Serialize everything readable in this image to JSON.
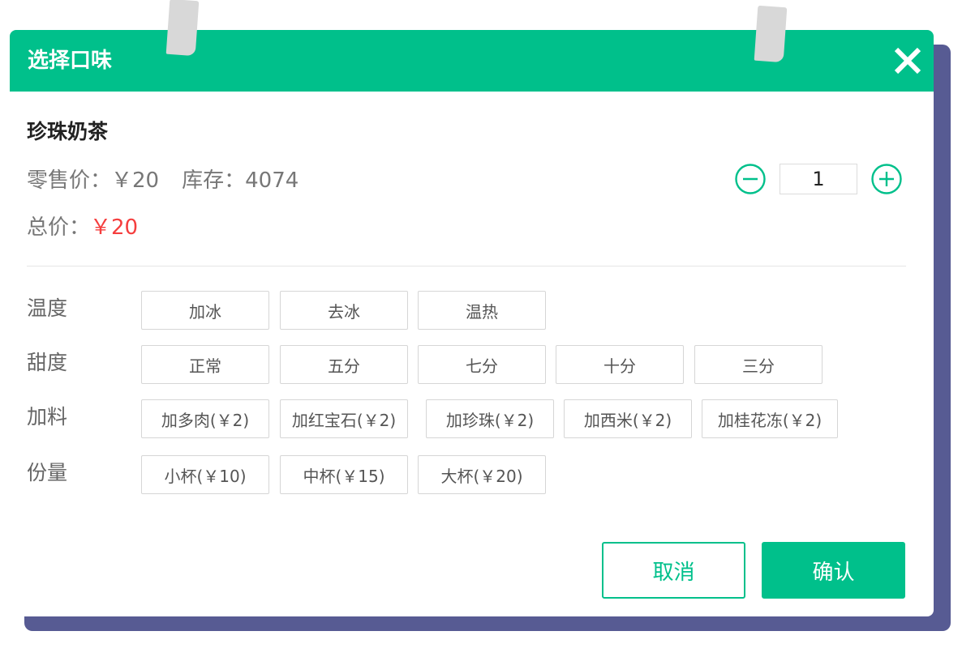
{
  "dialog": {
    "title": "选择口味",
    "close_icon": "close-icon"
  },
  "product": {
    "name": "珍珠奶茶",
    "retail_label": "零售价：",
    "retail_price": "￥20",
    "stock_label": "库存：",
    "stock": "4074",
    "total_label": "总价：",
    "total_price": "￥20"
  },
  "quantity": {
    "value": "1",
    "minus_icon": "minus-circle-icon",
    "plus_icon": "plus-circle-icon"
  },
  "options": {
    "temperature": {
      "label": "温度",
      "items": [
        "加冰",
        "去冰",
        "温热"
      ]
    },
    "sweetness": {
      "label": "甜度",
      "items": [
        "正常",
        "五分",
        "七分",
        "十分",
        "三分"
      ]
    },
    "toppings": {
      "label": "加料",
      "items": [
        "加多肉(￥2)",
        "加红宝石(￥2)",
        "加珍珠(￥2)",
        "加西米(￥2)",
        "加桂花冻(￥2)"
      ]
    },
    "size": {
      "label": "份量",
      "items": [
        "小杯(￥10)",
        "中杯(￥15)",
        "大杯(￥20)"
      ]
    }
  },
  "actions": {
    "cancel_label": "取消",
    "confirm_label": "确认"
  },
  "colors": {
    "accent": "#00c08b",
    "price_red": "#f53e3e",
    "backdrop": "#575b93"
  }
}
